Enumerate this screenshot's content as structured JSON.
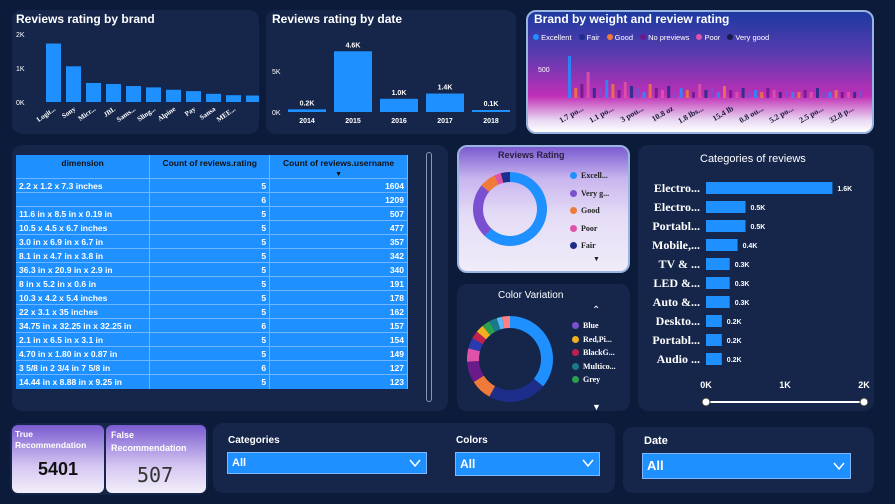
{
  "brand_chart": {
    "title": "Reviews rating by brand",
    "yticks": [
      "2K",
      "1K",
      "0K"
    ],
    "ymax": 2000,
    "categories": [
      "Logit...",
      "Sony",
      "Micr...",
      "JBL",
      "Sams...",
      "Sling...",
      "Alpine",
      "Pay",
      "Sansa",
      "MEE..."
    ],
    "values": [
      1720,
      1050,
      560,
      530,
      470,
      430,
      360,
      320,
      240,
      200,
      190
    ]
  },
  "date_chart": {
    "title": "Reviews rating by date",
    "yticks": [
      "5K",
      "0K"
    ],
    "ymax": 5000,
    "categories": [
      "2014",
      "2015",
      "2016",
      "2017",
      "2018"
    ],
    "values": [
      200,
      4600,
      1000,
      1400,
      100
    ],
    "labels": [
      "0.2K",
      "4.6K",
      "1.0K",
      "1.4K",
      "0.1K"
    ]
  },
  "weight_chart": {
    "title": "Brand by weight and review rating",
    "legend": [
      {
        "label": "Excellent",
        "color": "#1e90ff"
      },
      {
        "label": "Fair",
        "color": "#1c2e8a"
      },
      {
        "label": "Good",
        "color": "#f07a3a"
      },
      {
        "label": "No previews",
        "color": "#6a1a8a"
      },
      {
        "label": "Poor",
        "color": "#e052a8"
      },
      {
        "label": "Very good",
        "color": "#1a1a4a"
      }
    ],
    "ytick": "500",
    "xlabels": [
      "1.7 po...",
      "1.1 po...",
      "3 pou...",
      "10.8 oz",
      "1.8 lbs...",
      "15.4 lb",
      "0.8 ou...",
      "5.2 po...",
      "2.5 po...",
      "32.8 p..."
    ]
  },
  "table": {
    "headers": [
      "dimension",
      "Count of reviews.rating",
      "Count of reviews.username"
    ],
    "rows": [
      [
        "2.2 x 1.2 x 7.3 inches",
        "5",
        "1604"
      ],
      [
        "",
        "6",
        "1209"
      ],
      [
        "11.6 in x 8.5 in x 0.19 in",
        "5",
        "507"
      ],
      [
        "10.5 x 4.5 x 6.7 inches",
        "5",
        "477"
      ],
      [
        "3.0 in x 6.9 in x 6.7 in",
        "5",
        "357"
      ],
      [
        "8.1 in x 4.7 in x 3.8 in",
        "5",
        "342"
      ],
      [
        "36.3 in x 20.9 in x 2.9 in",
        "5",
        "340"
      ],
      [
        "8 in x 5.2 in x 0.6 in",
        "5",
        "191"
      ],
      [
        "10.3 x 4.2 x 5.4 inches",
        "5",
        "178"
      ],
      [
        "22 x 3.1 x 35 inches",
        "5",
        "162"
      ],
      [
        "34.75 in x 32.25 in x 32.25 in",
        "6",
        "157"
      ],
      [
        "2.1 in x 6.5 in x 3.1 in",
        "5",
        "154"
      ],
      [
        "4.70 in x 1.80 in x 0.87 in",
        "5",
        "149"
      ],
      [
        "3 5/8 in 2 3/4 in 7 5/8 in",
        "6",
        "127"
      ],
      [
        "14.44 in x 8.88 in x 9.25 in",
        "5",
        "123"
      ]
    ]
  },
  "reviews_rating": {
    "title": "Reviews Rating",
    "legend": [
      {
        "label": "Excell...",
        "color": "#1e90ff"
      },
      {
        "label": "Very g...",
        "color": "#7a4fd0"
      },
      {
        "label": "Good",
        "color": "#f07a3a"
      },
      {
        "label": "Poor",
        "color": "#e052a8"
      },
      {
        "label": "Fair",
        "color": "#1c2e8a"
      }
    ],
    "slices": [
      {
        "value": 62,
        "color": "#1e90ff"
      },
      {
        "value": 24,
        "color": "#7a4fd0"
      },
      {
        "value": 7,
        "color": "#f07a3a"
      },
      {
        "value": 3,
        "color": "#e052a8"
      },
      {
        "value": 4,
        "color": "#1c2e8a"
      }
    ]
  },
  "color_variation": {
    "title": "Color Variation",
    "legend": [
      {
        "label": "Blue",
        "color": "#7a4fd0"
      },
      {
        "label": "Red,Pi...",
        "color": "#f0b020"
      },
      {
        "label": "BlackG...",
        "color": "#c02050"
      },
      {
        "label": "Multico...",
        "color": "#1a7a8a"
      },
      {
        "label": "Grey",
        "color": "#2aa050"
      }
    ],
    "slices": [
      {
        "value": 36,
        "color": "#1e90ff"
      },
      {
        "value": 22,
        "color": "#1c2e8a"
      },
      {
        "value": 8,
        "color": "#f07a3a"
      },
      {
        "value": 8,
        "color": "#6a1a8a"
      },
      {
        "value": 5,
        "color": "#e052a8"
      },
      {
        "value": 4,
        "color": "#2a3ab0"
      },
      {
        "value": 3,
        "color": "#c02050"
      },
      {
        "value": 3,
        "color": "#f0b020"
      },
      {
        "value": 3,
        "color": "#2aa050"
      },
      {
        "value": 3,
        "color": "#1a7a8a"
      },
      {
        "value": 2,
        "color": "#5ab8ff"
      },
      {
        "value": 3,
        "color": "#ff8080"
      }
    ]
  },
  "categories_chart": {
    "title": "Categories of reviews",
    "categories": [
      "Electro...",
      "Electro...",
      "Portabl...",
      "Mobile,...",
      "TV & ...",
      "LED &...",
      "Auto &...",
      "Deskto...",
      "Portabl...",
      "Audio ..."
    ],
    "values": [
      1600,
      500,
      500,
      400,
      300,
      300,
      300,
      200,
      200,
      200
    ],
    "labels": [
      "1.6K",
      "0.5K",
      "0.5K",
      "0.4K",
      "0.3K",
      "0.3K",
      "0.3K",
      "0.2K",
      "0.2K",
      "0.2K"
    ],
    "xticks": [
      "0K",
      "1K",
      "2K"
    ],
    "xmax": 2000
  },
  "cards": {
    "true_label": "True Recommendation",
    "true_value": "5401",
    "false_label": "False Recommendation",
    "false_value": "507"
  },
  "slicers": {
    "categories_label": "Categories",
    "categories_value": "All",
    "colors_label": "Colors",
    "colors_value": "All",
    "date_label": "Date",
    "date_value": "All"
  }
}
